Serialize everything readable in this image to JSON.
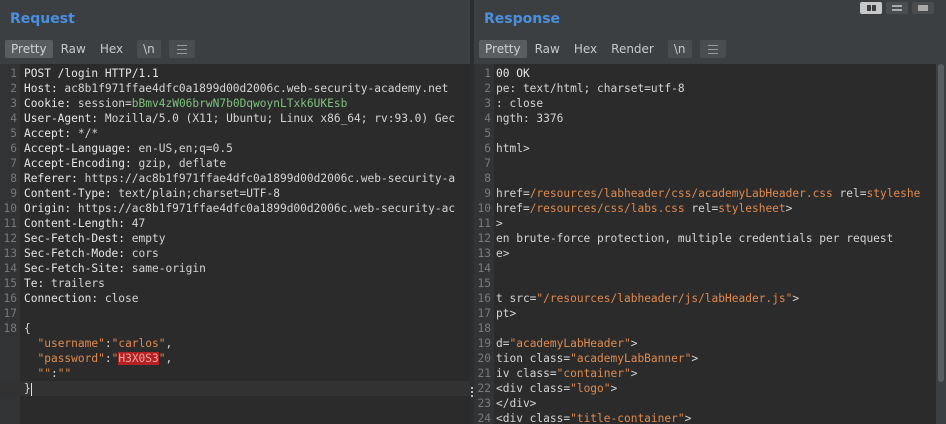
{
  "request": {
    "title": "Request",
    "tabs": [
      "Pretty",
      "Raw",
      "Hex",
      "\\n"
    ],
    "lines": [
      {
        "n": "1",
        "segs": [
          {
            "t": "POST /login HTTP/1.1",
            "c": "k"
          }
        ]
      },
      {
        "n": "2",
        "segs": [
          {
            "t": "Host: ",
            "c": "k"
          },
          {
            "t": "ac8b1f971ffae4dfc0a1899d00d2006c.web-security-academy.net",
            "c": "v"
          }
        ]
      },
      {
        "n": "3",
        "segs": [
          {
            "t": "Cookie: ",
            "c": "k"
          },
          {
            "t": "session",
            "c": "v"
          },
          {
            "t": "=",
            "c": "v"
          },
          {
            "t": "bBmv4zW06brwN7b0DqwoynLTxk6UKEsb",
            "c": "ck"
          }
        ]
      },
      {
        "n": "4",
        "segs": [
          {
            "t": "User-Agent: ",
            "c": "k"
          },
          {
            "t": "Mozilla/5.0 (X11; Ubuntu; Linux x86_64; rv:93.0) Gec",
            "c": "v"
          }
        ]
      },
      {
        "n": "5",
        "segs": [
          {
            "t": "Accept: ",
            "c": "k"
          },
          {
            "t": "*/*",
            "c": "v"
          }
        ]
      },
      {
        "n": "6",
        "segs": [
          {
            "t": "Accept-Language: ",
            "c": "k"
          },
          {
            "t": "en-US,en;q=0.5",
            "c": "v"
          }
        ]
      },
      {
        "n": "7",
        "segs": [
          {
            "t": "Accept-Encoding: ",
            "c": "k"
          },
          {
            "t": "gzip, deflate",
            "c": "v"
          }
        ]
      },
      {
        "n": "8",
        "segs": [
          {
            "t": "Referer: ",
            "c": "k"
          },
          {
            "t": "https://ac8b1f971ffae4dfc0a1899d00d2006c.web-security-a",
            "c": "v"
          }
        ]
      },
      {
        "n": "9",
        "segs": [
          {
            "t": "Content-Type: ",
            "c": "k"
          },
          {
            "t": "text/plain;charset=UTF-8",
            "c": "v"
          }
        ]
      },
      {
        "n": "10",
        "segs": [
          {
            "t": "Origin: ",
            "c": "k"
          },
          {
            "t": "https://ac8b1f971ffae4dfc0a1899d00d2006c.web-security-ac",
            "c": "v"
          }
        ]
      },
      {
        "n": "11",
        "segs": [
          {
            "t": "Content-Length: ",
            "c": "k"
          },
          {
            "t": "47",
            "c": "v"
          }
        ]
      },
      {
        "n": "12",
        "segs": [
          {
            "t": "Sec-Fetch-Dest: ",
            "c": "k"
          },
          {
            "t": "empty",
            "c": "v"
          }
        ]
      },
      {
        "n": "13",
        "segs": [
          {
            "t": "Sec-Fetch-Mode: ",
            "c": "k"
          },
          {
            "t": "cors",
            "c": "v"
          }
        ]
      },
      {
        "n": "14",
        "segs": [
          {
            "t": "Sec-Fetch-Site: ",
            "c": "k"
          },
          {
            "t": "same-origin",
            "c": "v"
          }
        ]
      },
      {
        "n": "15",
        "segs": [
          {
            "t": "Te: ",
            "c": "k"
          },
          {
            "t": "trailers",
            "c": "v"
          }
        ]
      },
      {
        "n": "16",
        "segs": [
          {
            "t": "Connection: ",
            "c": "k"
          },
          {
            "t": "close",
            "c": "v"
          }
        ]
      },
      {
        "n": "17",
        "segs": []
      },
      {
        "n": "18",
        "segs": [
          {
            "t": "{",
            "c": "v"
          }
        ]
      },
      {
        "n": "",
        "segs": [
          {
            "t": "  ",
            "c": "v"
          },
          {
            "t": "\"username\"",
            "c": "str"
          },
          {
            "t": ":",
            "c": "v"
          },
          {
            "t": "\"carlos\"",
            "c": "str"
          },
          {
            "t": ",",
            "c": "v"
          }
        ]
      },
      {
        "n": "",
        "segs": [
          {
            "t": "  ",
            "c": "v"
          },
          {
            "t": "\"password\"",
            "c": "str"
          },
          {
            "t": ":",
            "c": "v"
          },
          {
            "t": "\"",
            "c": "str"
          },
          {
            "t": "H3X0S3",
            "c": "hl"
          },
          {
            "t": "\"",
            "c": "str"
          },
          {
            "t": ",",
            "c": "v"
          }
        ]
      },
      {
        "n": "",
        "segs": [
          {
            "t": "  ",
            "c": "v"
          },
          {
            "t": "\"\"",
            "c": "str"
          },
          {
            "t": ":",
            "c": "v"
          },
          {
            "t": "\"\"",
            "c": "str"
          }
        ]
      },
      {
        "n": "",
        "segs": [
          {
            "t": "}",
            "c": "v"
          }
        ],
        "cursor": true,
        "current": true
      }
    ]
  },
  "response": {
    "title": "Response",
    "tabs": [
      "Pretty",
      "Raw",
      "Hex",
      "Render",
      "\\n"
    ],
    "lines": [
      {
        "n": "1",
        "segs": [
          {
            "t": "00 OK",
            "c": "k"
          }
        ]
      },
      {
        "n": "2",
        "segs": [
          {
            "t": "pe: text/html; charset=utf-8",
            "c": "v"
          }
        ]
      },
      {
        "n": "3",
        "segs": [
          {
            "t": ": close",
            "c": "v"
          }
        ]
      },
      {
        "n": "4",
        "segs": [
          {
            "t": "ngth: 3376",
            "c": "v"
          }
        ]
      },
      {
        "n": "5",
        "segs": []
      },
      {
        "n": "6",
        "segs": [
          {
            "t": "html>",
            "c": "v"
          }
        ]
      },
      {
        "n": "7",
        "segs": []
      },
      {
        "n": "8",
        "segs": []
      },
      {
        "n": "9",
        "segs": [
          {
            "t": "href=",
            "c": "v"
          },
          {
            "t": "/resources/labheader/css/academyLabHeader.css",
            "c": "str"
          },
          {
            "t": " rel=",
            "c": "v"
          },
          {
            "t": "styleshe",
            "c": "str"
          }
        ]
      },
      {
        "n": "10",
        "segs": [
          {
            "t": "href=",
            "c": "v"
          },
          {
            "t": "/resources/css/labs.css",
            "c": "str"
          },
          {
            "t": " rel=",
            "c": "v"
          },
          {
            "t": "stylesheet",
            "c": "str"
          },
          {
            "t": ">",
            "c": "v"
          }
        ]
      },
      {
        "n": "11",
        "segs": [
          {
            "t": ">",
            "c": "v"
          }
        ]
      },
      {
        "n": "12",
        "segs": [
          {
            "t": "en brute-force protection, multiple credentials per request",
            "c": "v"
          }
        ]
      },
      {
        "n": "13",
        "segs": [
          {
            "t": "e>",
            "c": "v"
          }
        ]
      },
      {
        "n": "14",
        "segs": []
      },
      {
        "n": "15",
        "segs": []
      },
      {
        "n": "16",
        "segs": [
          {
            "t": "t src=",
            "c": "v"
          },
          {
            "t": "\"/resources/labheader/js/labHeader.js\"",
            "c": "str"
          },
          {
            "t": ">",
            "c": "v"
          }
        ]
      },
      {
        "n": "17",
        "segs": [
          {
            "t": "pt>",
            "c": "v"
          }
        ]
      },
      {
        "n": "18",
        "segs": []
      },
      {
        "n": "19",
        "segs": [
          {
            "t": "d=",
            "c": "v"
          },
          {
            "t": "\"academyLabHeader\"",
            "c": "str"
          },
          {
            "t": ">",
            "c": "v"
          }
        ]
      },
      {
        "n": "20",
        "segs": [
          {
            "t": "tion class=",
            "c": "v"
          },
          {
            "t": "\"academyLabBanner\"",
            "c": "str"
          },
          {
            "t": ">",
            "c": "v"
          }
        ]
      },
      {
        "n": "21",
        "segs": [
          {
            "t": "iv class=",
            "c": "v"
          },
          {
            "t": "\"container\"",
            "c": "str"
          },
          {
            "t": ">",
            "c": "v"
          }
        ]
      },
      {
        "n": "22",
        "segs": [
          {
            "t": "<div class=",
            "c": "v"
          },
          {
            "t": "\"logo\"",
            "c": "str"
          },
          {
            "t": ">",
            "c": "v"
          }
        ]
      },
      {
        "n": "23",
        "segs": [
          {
            "t": "</div>",
            "c": "v"
          }
        ]
      },
      {
        "n": "24",
        "segs": [
          {
            "t": "<div class=",
            "c": "v"
          },
          {
            "t": "\"title-container\"",
            "c": "str"
          },
          {
            "t": ">",
            "c": "v"
          }
        ]
      }
    ]
  }
}
